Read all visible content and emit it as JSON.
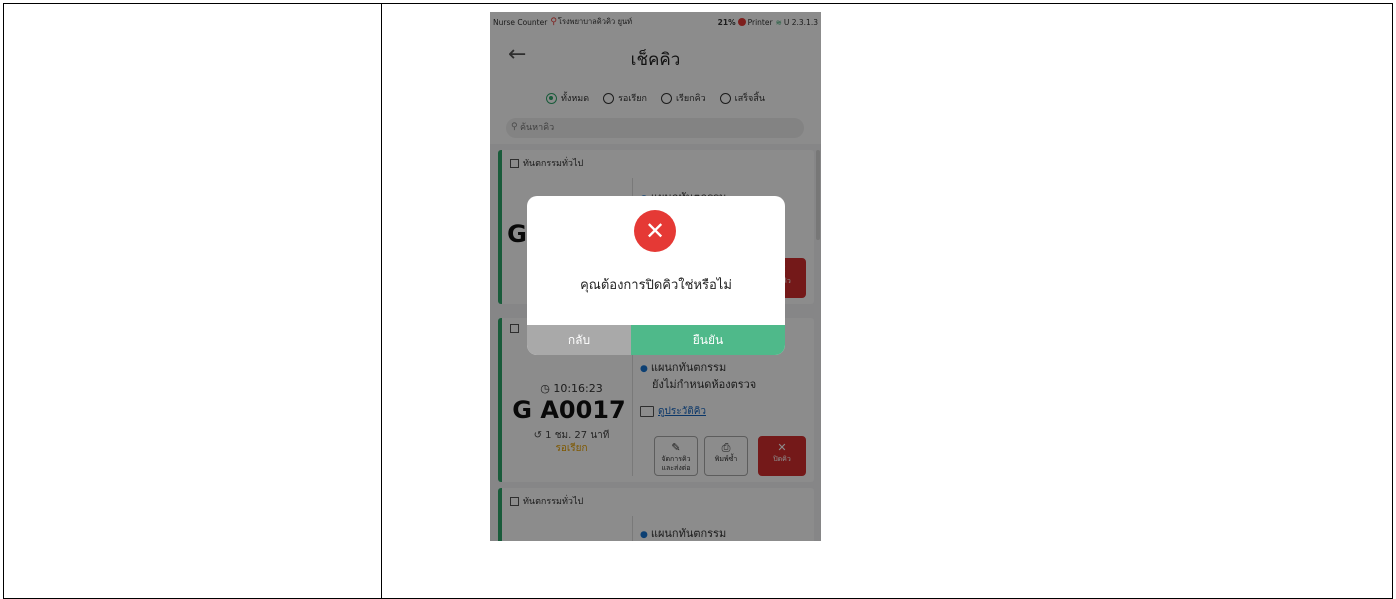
{
  "status_bar": {
    "app": "Nurse Counter",
    "hospital": "โรงพยาบาลคิวคิว ยูนท์",
    "battery": "21%",
    "printer": "Printer",
    "version": "U 2.3.1.3"
  },
  "header": {
    "title": "เช็คคิว"
  },
  "filters": [
    {
      "label": "ทั้งหมด",
      "selected": true
    },
    {
      "label": "รอเรียก",
      "selected": false
    },
    {
      "label": "เรียกคิว",
      "selected": false
    },
    {
      "label": "เสร็จสิ้น",
      "selected": false
    }
  ],
  "search": {
    "placeholder": "ค้นหาคิว"
  },
  "cards": [
    {
      "category": "ทันตกรรมทั่วไป",
      "department": "แผนกทันตกรรม",
      "queue_no_partial": "G",
      "close_label": "ปิดคิว"
    },
    {
      "department": "แผนกทันตกรรม",
      "room": "ยังไม่กำหนดห้องตรวจ",
      "time": "10:16:23",
      "queue_no": "G A0017",
      "wait": "1 ชม. 27 นาที",
      "state": "รอเรียก",
      "history": "ดูประวัติคิว",
      "btn_manage": "จัดการคิว และส่งต่อ",
      "btn_print": "พิมพ์ซ้ำ",
      "btn_close": "ปิดคิว"
    },
    {
      "category": "ทันตกรรมทั่วไป",
      "department": "แผนกทันตกรรม"
    }
  ],
  "dialog": {
    "message": "คุณต้องการปิดคิวใช่หรือไม่",
    "back_label": "กลับ",
    "confirm_label": "ยืนยัน",
    "icon": "error-x-icon"
  },
  "colors": {
    "accent_green": "#2ea66a",
    "confirm_green": "#4fb98a",
    "danger_red": "#e53935",
    "pending_orange": "#e6a000"
  }
}
